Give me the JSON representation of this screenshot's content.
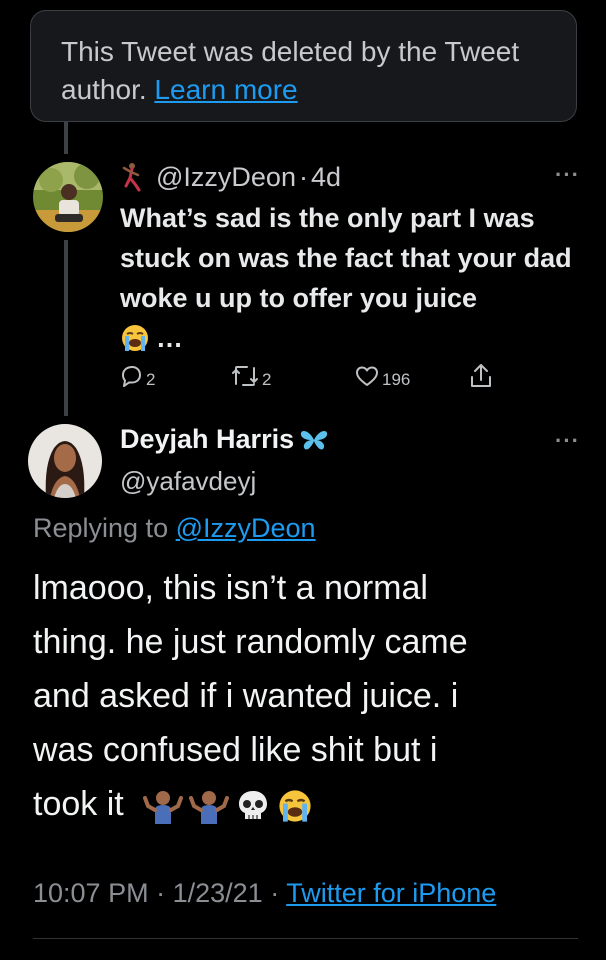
{
  "deleted_notice": {
    "text": "This Tweet was deleted by the Tweet author.",
    "link_label": "Learn more"
  },
  "parent_tweet": {
    "handle": "@IzzyDeon",
    "separator": "·",
    "age": "4d",
    "more_label": "···",
    "text": "What’s sad is the only part I was stuck on was the fact that your dad woke u up to offer you juice",
    "trailing_text": "…",
    "emoji": "loudly-crying-face",
    "actions": {
      "reply_count": "2",
      "retweet_count": "2",
      "like_count": "196"
    }
  },
  "reply_tweet": {
    "display_name": "Deyjah Harris",
    "badge_icon": "butterfly-icon",
    "handle": "@yafavdeyj",
    "more_label": "···",
    "replying_to_prefix": "Replying to",
    "replying_to_handle": "@IzzyDeon",
    "text_lines": [
      "lmaooo, this isn’t a normal",
      "thing. he just randomly came",
      "and asked if i wanted juice. i",
      "was confused like shit but i",
      "took it"
    ],
    "trailing_emojis": [
      "man-shrugging",
      "man-shrugging",
      "skull",
      "loudly-crying-face"
    ],
    "time": "10:07 PM",
    "date": "1/23/21",
    "meta_separator": "·",
    "source": "Twitter for iPhone"
  },
  "colors": {
    "background": "#000000",
    "accent": "#1d9bf0",
    "text_primary": "#e7e9ea",
    "text_secondary": "#8b8f94",
    "badge": "#5bc0eb"
  }
}
